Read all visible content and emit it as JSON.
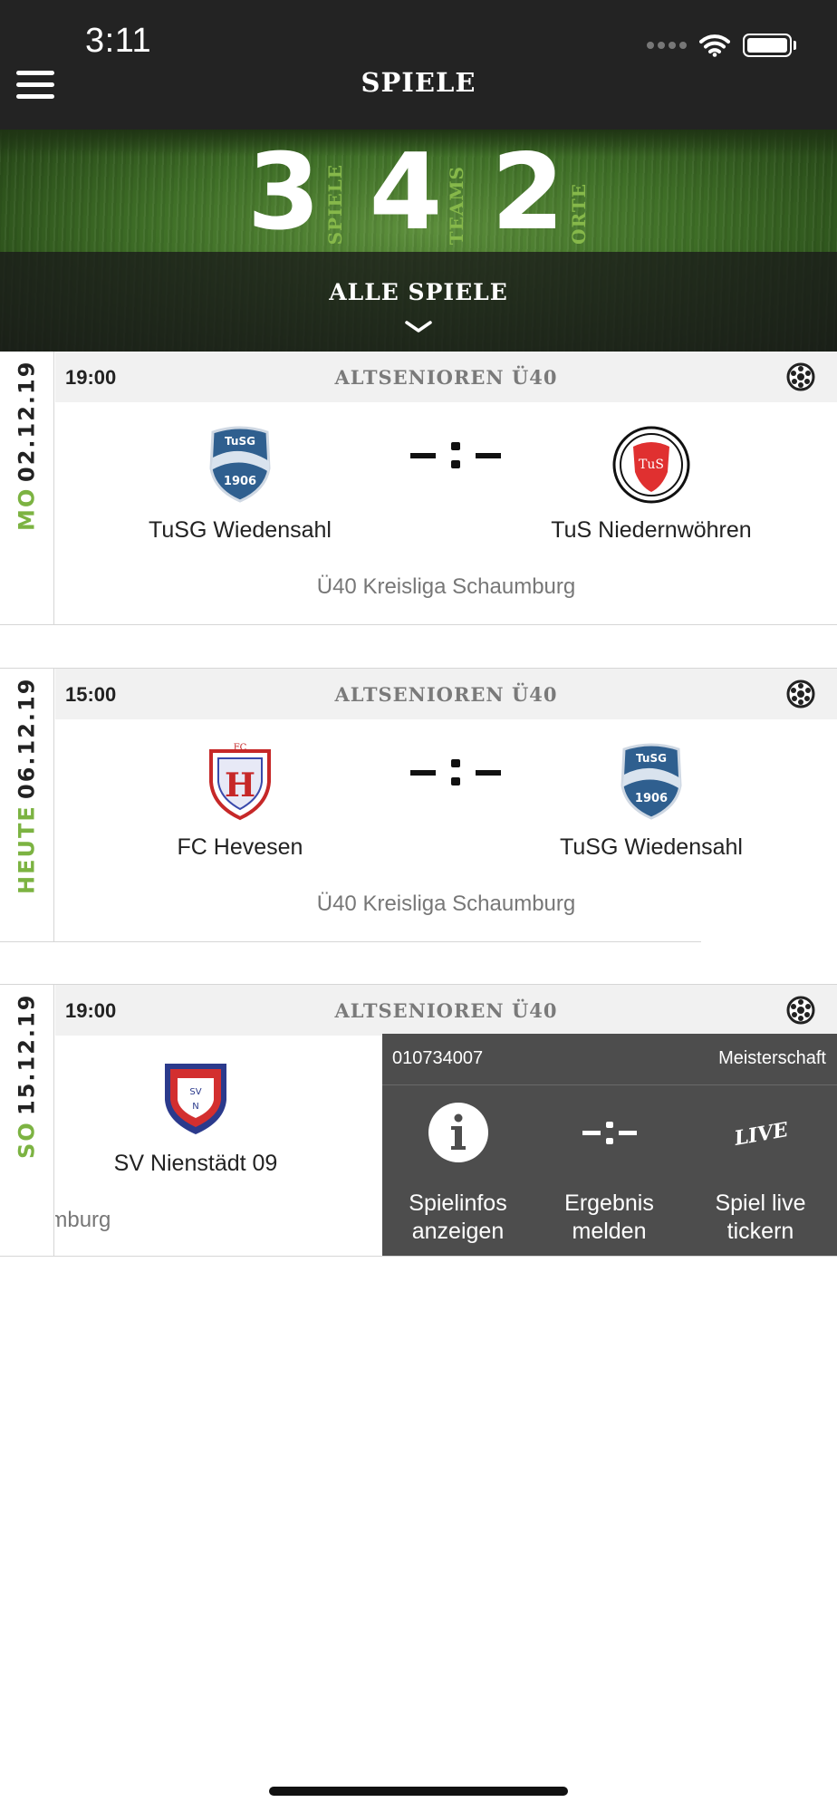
{
  "status_bar": {
    "time": "3:11"
  },
  "nav": {
    "title": "SPIELE"
  },
  "stats": [
    {
      "number": "3",
      "label": "SPIELE"
    },
    {
      "number": "4",
      "label": "TEAMS"
    },
    {
      "number": "2",
      "label": "ORTE"
    }
  ],
  "filter": {
    "label": "ALLE SPIELE"
  },
  "games": [
    {
      "date": "02.12.19",
      "day": "MO",
      "time": "19:00",
      "category": "ALTSENIOREN Ü40",
      "home": "TuSG Wiedensahl",
      "away": "TuS Niedernwöhren",
      "score": "-:-",
      "league": "Ü40 Kreisliga Schaumburg"
    },
    {
      "date": "06.12.19",
      "day": "HEUTE",
      "time": "15:00",
      "category": "ALTSENIOREN Ü40",
      "home": "FC Hevesen",
      "away": "TuSG Wiedensahl",
      "score": "-:-",
      "league": "Ü40 Kreisliga Schaumburg"
    },
    {
      "date": "15.12.19",
      "day": "SO",
      "time": "19:00",
      "category": "ALTSENIOREN Ü40",
      "home": "SV Nienstädt 09",
      "league_partial": "umburg"
    }
  ],
  "action_panel": {
    "game_id": "010734007",
    "type": "Meisterschaft",
    "buttons": [
      {
        "label": "Spielinfos\nanzeigen",
        "icon": "info-icon"
      },
      {
        "label": "Ergebnis\nmelden",
        "icon": "score-report-icon"
      },
      {
        "label": "Spiel live\ntickern",
        "icon": "live-icon",
        "icon_text": "LIVE"
      }
    ]
  },
  "colors": {
    "accent_green": "#7cb342",
    "nav_bg": "#232323",
    "panel_bg": "#4d4d4d"
  }
}
